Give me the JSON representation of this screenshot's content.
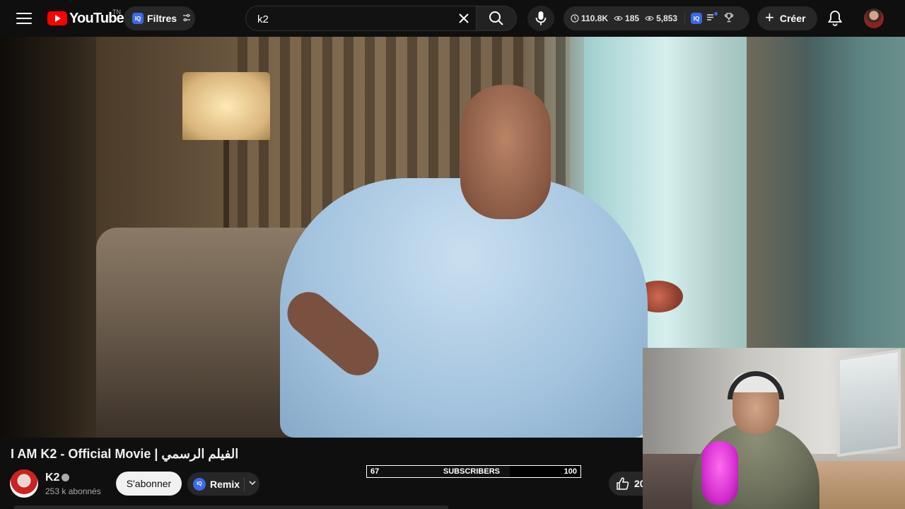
{
  "header": {
    "logo_text": "YouTube",
    "country_code": "TN",
    "filters_label": "Filtres",
    "iq_badge": "IQ",
    "search": {
      "value": "k2",
      "placeholder": ""
    },
    "stats": [
      {
        "icon": "clock-icon",
        "value": "110.8K"
      },
      {
        "icon": "eye-icon",
        "value": "185"
      },
      {
        "icon": "eye-icon",
        "value": "5,853"
      }
    ],
    "create_label": "Créer"
  },
  "video": {
    "title": "I AM K2 - Official Movie | الفيلم الرسمي"
  },
  "channel": {
    "name": "K2",
    "subscribers": "253 k abonnés",
    "subscribe_label": "S'abonner",
    "remix_label": "Remix"
  },
  "subscriber_goal": {
    "current": "67",
    "label": "SUBSCRIBERS",
    "target": "100",
    "progress": 0.67
  },
  "actions": {
    "like_count": "20"
  },
  "colors": {
    "brand_red": "#ff0000",
    "iq_blue": "#3d68e8",
    "background": "#0f0f0f"
  }
}
